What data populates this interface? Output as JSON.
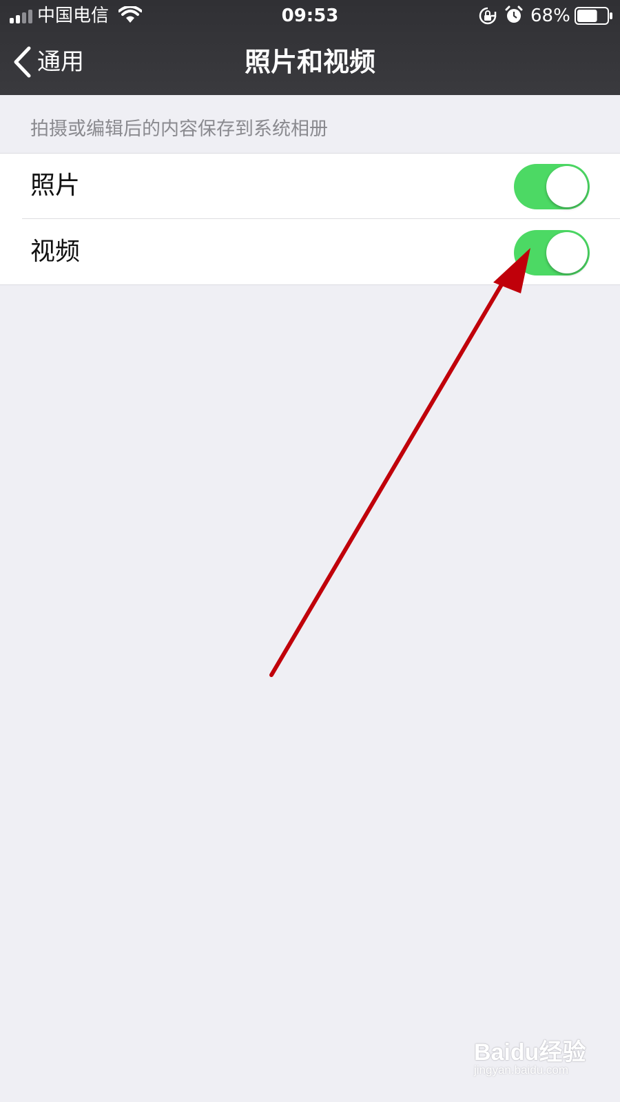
{
  "status_bar": {
    "carrier": "中国电信",
    "time": "09:53",
    "battery_percent": "68%",
    "battery_level": 0.68,
    "icons": [
      "signal-icon",
      "wifi-icon",
      "rotation-lock-icon",
      "alarm-icon",
      "battery-icon"
    ]
  },
  "nav": {
    "back_label": "通用",
    "title": "照片和视频"
  },
  "section": {
    "header": "拍摄或编辑后的内容保存到系统相册",
    "rows": [
      {
        "label": "照片",
        "toggle_on": true
      },
      {
        "label": "视频",
        "toggle_on": true
      }
    ]
  },
  "annotation": {
    "color": "#c0000a",
    "points_to": "视频"
  },
  "colors": {
    "nav_background": "#333337",
    "page_background": "#efeff4",
    "toggle_on": "#4cd964",
    "secondary_text": "#8a8a8f"
  },
  "watermark": {
    "logo": "Baidu经验",
    "url": "jingyan.baidu.com"
  }
}
